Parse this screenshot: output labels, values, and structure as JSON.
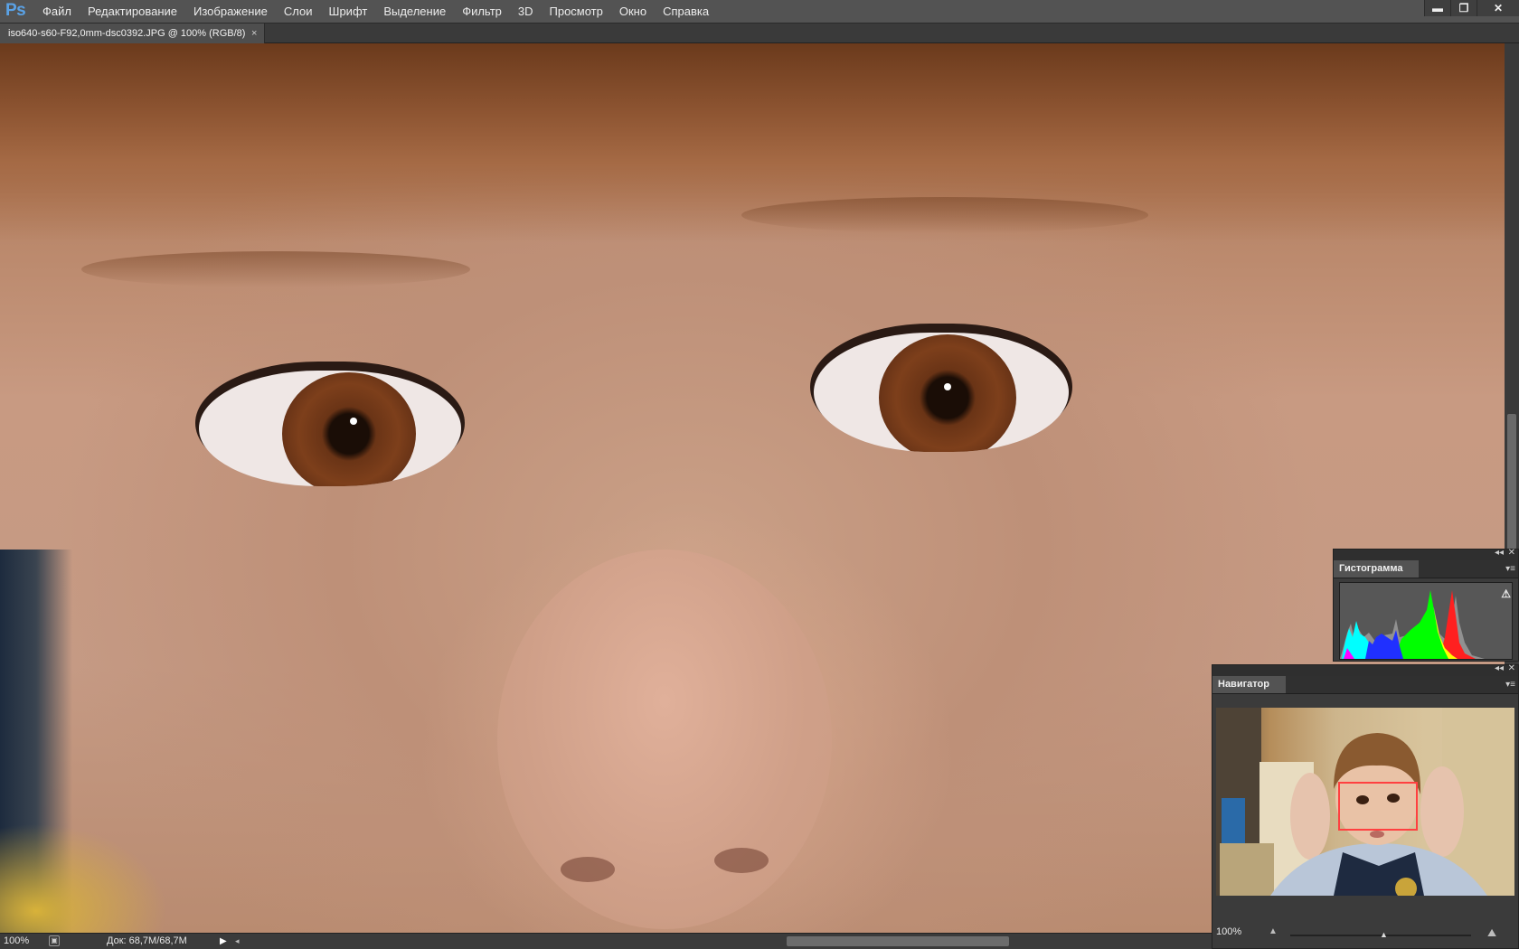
{
  "app": {
    "logo": "Ps"
  },
  "menu": [
    "Файл",
    "Редактирование",
    "Изображение",
    "Слои",
    "Шрифт",
    "Выделение",
    "Фильтр",
    "3D",
    "Просмотр",
    "Окно",
    "Справка"
  ],
  "window_controls": {
    "minimize": "▬",
    "restore": "❐",
    "close": "✕"
  },
  "document": {
    "tab_title": "iso640-s60-F92,0mm-dsc0392.JPG @ 100% (RGB/8)",
    "tab_close": "×"
  },
  "status": {
    "zoom": "100%",
    "doc_size": "Док: 68,7M/68,7M",
    "menu_arrow": "▶",
    "scroll_left_arrow": "◂"
  },
  "panels": {
    "histogram": {
      "title": "Гистограмма",
      "warning": "⚠",
      "collapse": "◂◂",
      "close": "✕",
      "menu": "▾≡"
    },
    "navigator": {
      "title": "Навигатор",
      "zoom": "100%",
      "collapse": "◂◂",
      "close": "✕",
      "menu": "▾≡",
      "zoom_out_icon": "small-mountain-icon",
      "zoom_in_icon": "large-mountain-icon"
    }
  },
  "colors": {
    "ps_blue": "#5aa2e6",
    "nav_view_box": "#ff4040"
  }
}
